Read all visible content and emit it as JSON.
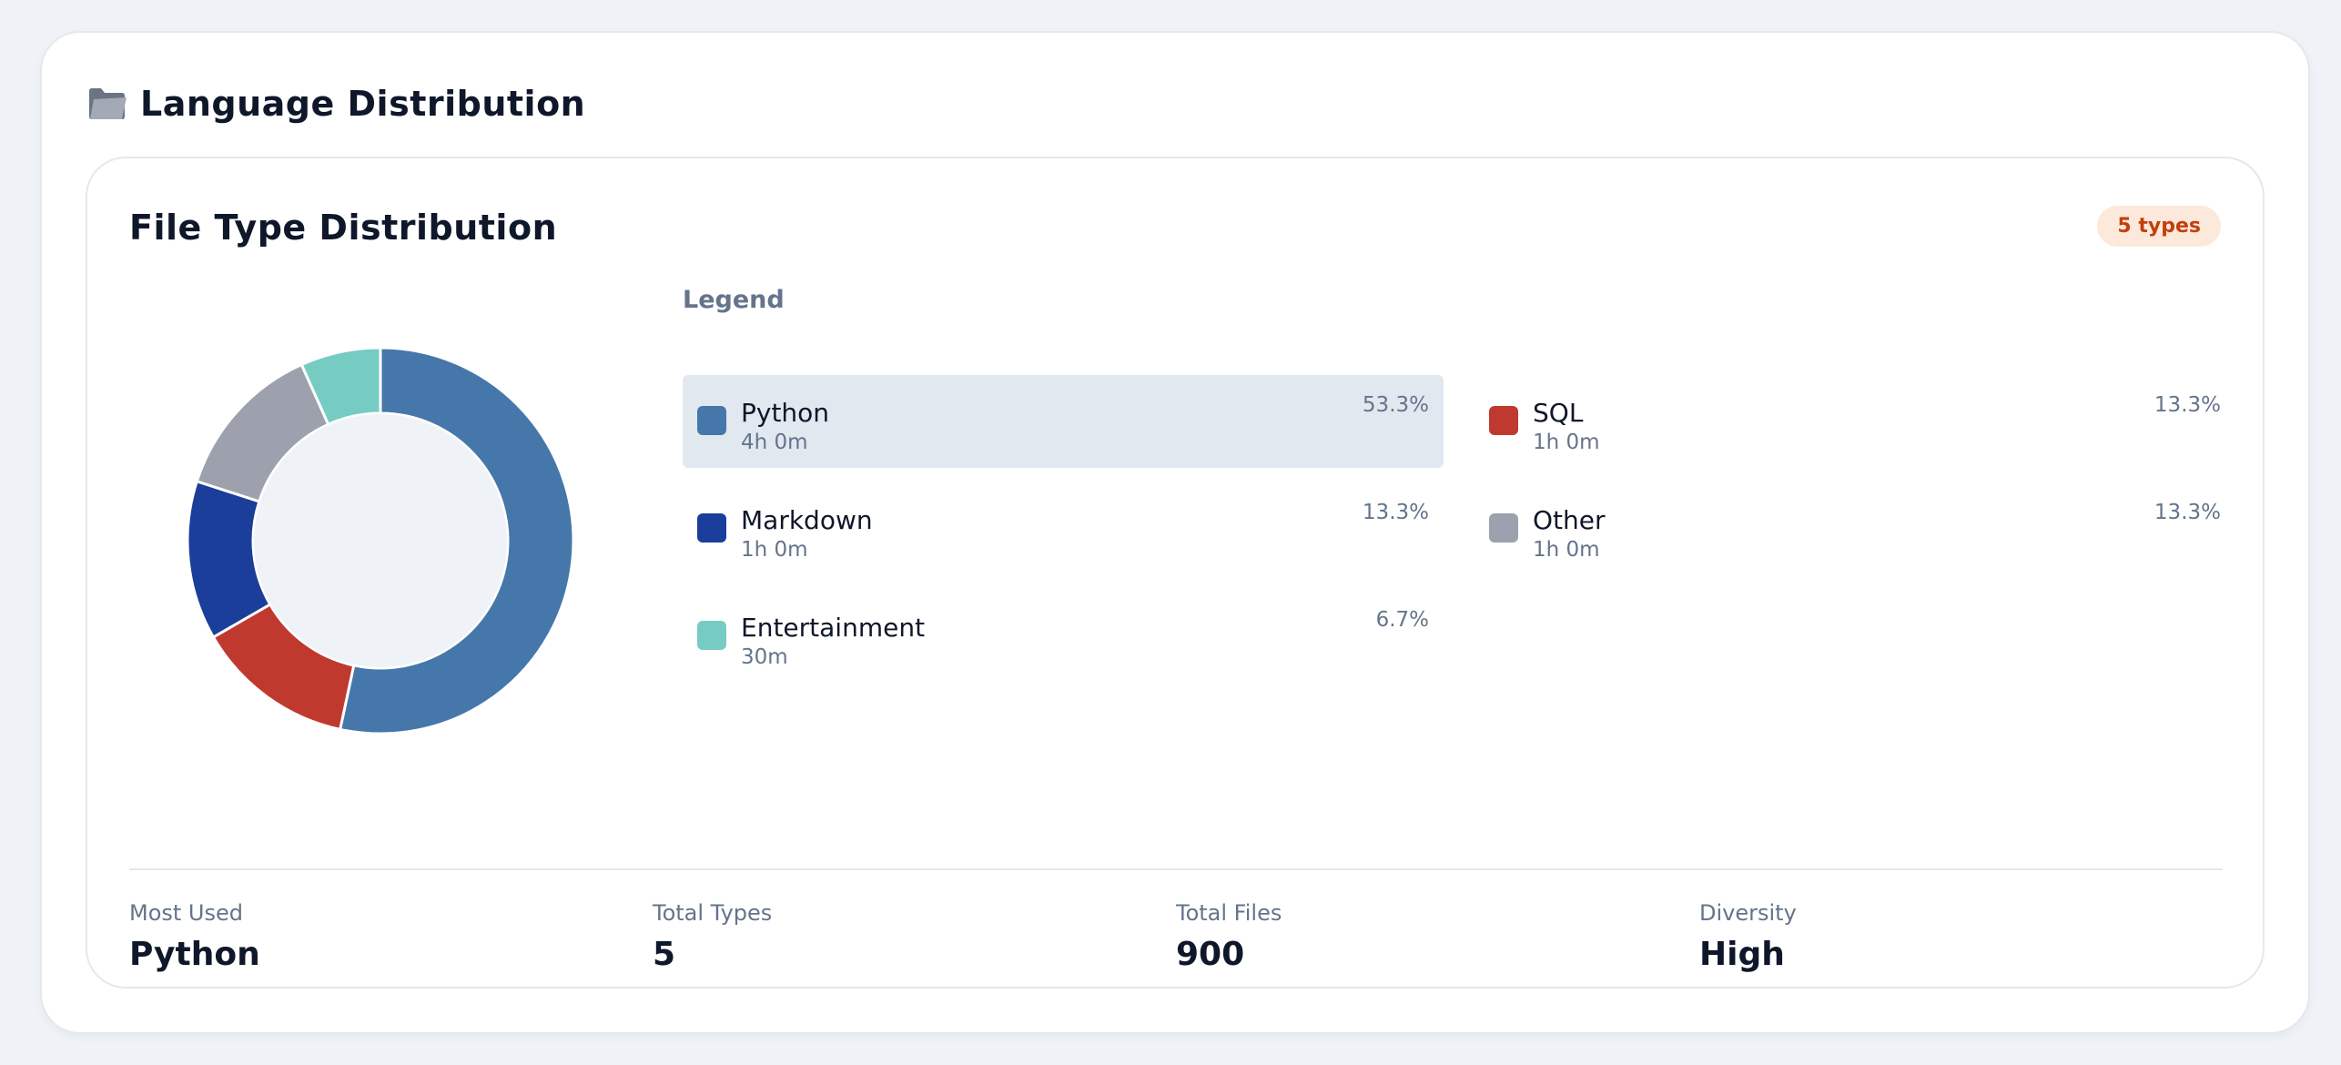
{
  "section": {
    "title": "Language Distribution",
    "icon": "folder-icon"
  },
  "card": {
    "title": "File Type Distribution",
    "badge": "5 types"
  },
  "legend": {
    "title": "Legend",
    "items": [
      {
        "name": "Python",
        "time": "4h 0m",
        "percent": "53.3%",
        "color": "#4677aa",
        "active": true
      },
      {
        "name": "SQL",
        "time": "1h 0m",
        "percent": "13.3%",
        "color": "#c0392f",
        "active": false
      },
      {
        "name": "Markdown",
        "time": "1h 0m",
        "percent": "13.3%",
        "color": "#1b3e9a",
        "active": false
      },
      {
        "name": "Other",
        "time": "1h 0m",
        "percent": "13.3%",
        "color": "#9ca1ad",
        "active": false
      },
      {
        "name": "Entertainment",
        "time": "30m",
        "percent": "6.7%",
        "color": "#76ccc3",
        "active": false
      }
    ]
  },
  "chart_data": {
    "type": "pie",
    "categories": [
      "Python",
      "SQL",
      "Markdown",
      "Other",
      "Entertainment"
    ],
    "values": [
      53.3,
      13.3,
      13.3,
      13.3,
      6.7
    ],
    "colors": [
      "#4677aa",
      "#c0392f",
      "#1b3e9a",
      "#9ca1ad",
      "#76ccc3"
    ],
    "donut": true
  },
  "stats": [
    {
      "label": "Most Used",
      "value": "Python"
    },
    {
      "label": "Total Types",
      "value": "5"
    },
    {
      "label": "Total Files",
      "value": "900"
    },
    {
      "label": "Diversity",
      "value": "High"
    }
  ]
}
